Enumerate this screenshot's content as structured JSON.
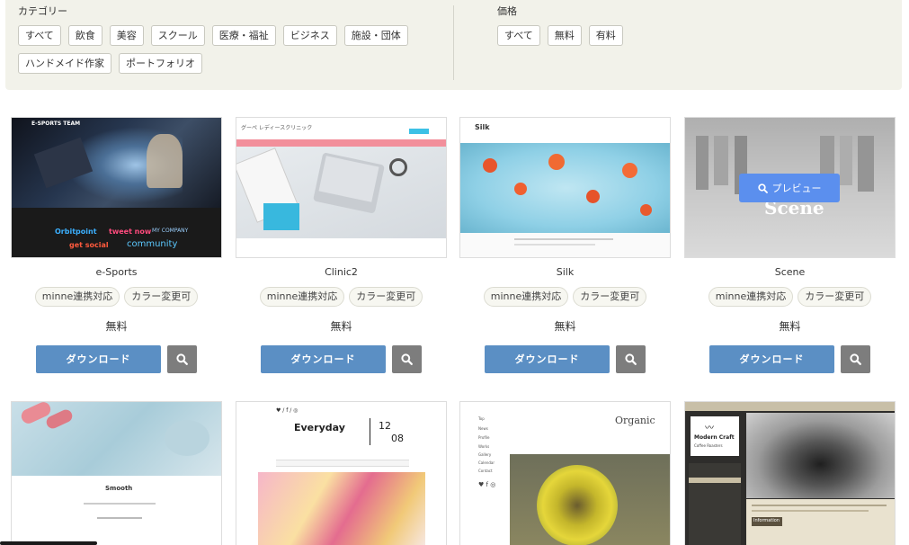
{
  "filters": {
    "category": {
      "title": "カテゴリー",
      "options": [
        "すべて",
        "飲食",
        "美容",
        "スクール",
        "医療・福祉",
        "ビジネス",
        "施設・団体",
        "ハンドメイド作家",
        "ポートフォリオ"
      ]
    },
    "price": {
      "title": "価格",
      "options": [
        "すべて",
        "無料",
        "有料"
      ]
    }
  },
  "templates": [
    {
      "name": "e-Sports",
      "tags": [
        "minne連携対応",
        "カラー変更可"
      ],
      "price": "無料",
      "download_label": "ダウンロード",
      "thumb": {
        "header": "E-SPORTS TEAM",
        "logos": [
          "Orbitpoint",
          "tweet now",
          "MY COMPANY",
          "get social",
          "community"
        ]
      }
    },
    {
      "name": "Clinic2",
      "tags": [
        "minne連携対応",
        "カラー変更可"
      ],
      "price": "無料",
      "download_label": "ダウンロード",
      "thumb": {
        "header": "グーペ レディースクリニック"
      }
    },
    {
      "name": "Silk",
      "tags": [
        "minne連携対応",
        "カラー変更可"
      ],
      "price": "無料",
      "download_label": "ダウンロード",
      "thumb": {
        "header": "Silk"
      }
    },
    {
      "name": "Scene",
      "tags": [
        "minne連携対応",
        "カラー変更可"
      ],
      "price": "無料",
      "download_label": "ダウンロード",
      "preview_label": "プレビュー",
      "thumb": {
        "header": "Scene"
      }
    },
    {
      "name": "Smooth",
      "thumb": {
        "header": "Smooth"
      }
    },
    {
      "name": "Everyday",
      "thumb": {
        "header": "Everyday",
        "date_top": "12",
        "date_bottom": "08"
      }
    },
    {
      "name": "Organic",
      "thumb": {
        "header": "Organic",
        "menu": [
          "Top",
          "News",
          "Profile",
          "Works",
          "Gallery",
          "Calendar",
          "Contact"
        ]
      }
    },
    {
      "name": "Modern Craft",
      "thumb": {
        "header": "Modern Craft",
        "sub": "Coffee Roasters",
        "section": "Information"
      }
    }
  ],
  "colors": {
    "filter_bg": "#f2f2ea",
    "download": "#5b8fc4",
    "search": "#7d7d7d",
    "preview": "#5b8fee"
  },
  "icons": {
    "search": "magnifier-icon"
  }
}
